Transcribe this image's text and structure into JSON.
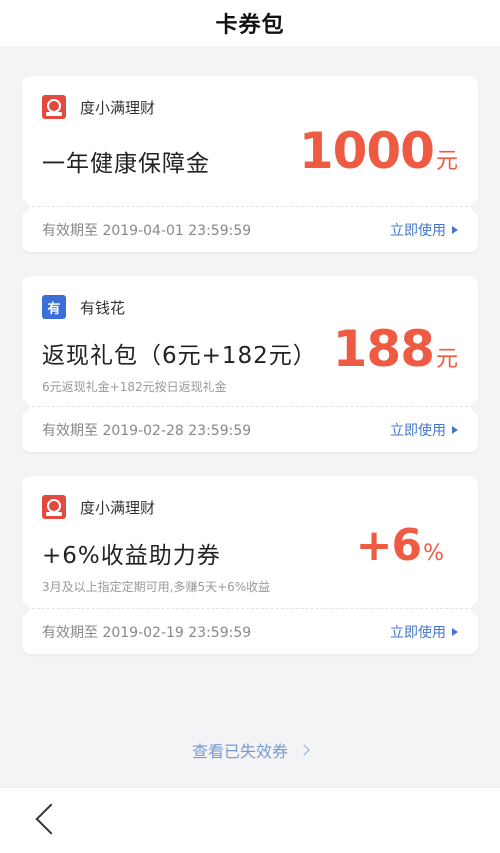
{
  "header": {
    "title": "卡券包"
  },
  "coupons": [
    {
      "brand": "度小满理财",
      "brand_icon": "duxiaoman-logo-icon",
      "title": "一年健康保障金",
      "subtitle": "",
      "amount": "1000",
      "unit": "元",
      "expiry": "有效期至 2019-04-01 23:59:59",
      "action": "立即使用"
    },
    {
      "brand": "有钱花",
      "brand_icon": "youqianhua-logo-icon",
      "brand_icon_glyph": "有",
      "title": "返现礼包（6元+182元）",
      "subtitle": "6元返现礼金+182元按日返现礼金",
      "amount": "188",
      "unit": "元",
      "expiry": "有效期至 2019-02-28 23:59:59",
      "action": "立即使用"
    },
    {
      "brand": "度小满理财",
      "brand_icon": "duxiaoman-logo-icon",
      "title": "+6%收益助力券",
      "subtitle": "3月及以上指定定期可用,多赚5天+6%收益",
      "amount": "+6",
      "unit": "%",
      "expiry": "有效期至 2019-02-19 23:59:59",
      "action": "立即使用"
    }
  ],
  "footer": {
    "link": "查看已失效券"
  },
  "colors": {
    "accent": "#ef5a43",
    "link": "#4677c9",
    "background": "#f4f4f6"
  }
}
